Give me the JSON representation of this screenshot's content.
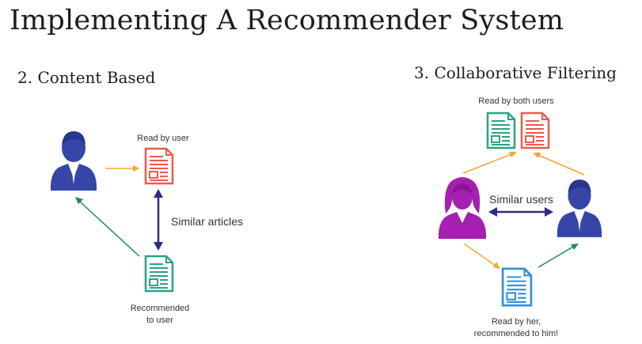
{
  "title": "Implementing A Recommender System",
  "content_based": {
    "heading": "2. Content Based",
    "read_label": "Read by user",
    "similar_label": "Similar articles",
    "recommended_label_line1": "Recommended",
    "recommended_label_line2": "to user"
  },
  "collaborative": {
    "heading": "3. Collaborative Filtering",
    "read_both_label": "Read by both users",
    "similar_users_label": "Similar users",
    "read_her_line1": "Read by her,",
    "read_her_line2": "recommended to him!"
  },
  "colors": {
    "user_blue": "#3546a8",
    "user_purple": "#a51fb0",
    "doc_red": "#ec5b4b",
    "doc_teal": "#2aa383",
    "doc_blue": "#2f8fd8",
    "arrow_orange": "#f6a531",
    "arrow_green": "#1f8a5a",
    "arrow_navy": "#2c2a8a"
  }
}
